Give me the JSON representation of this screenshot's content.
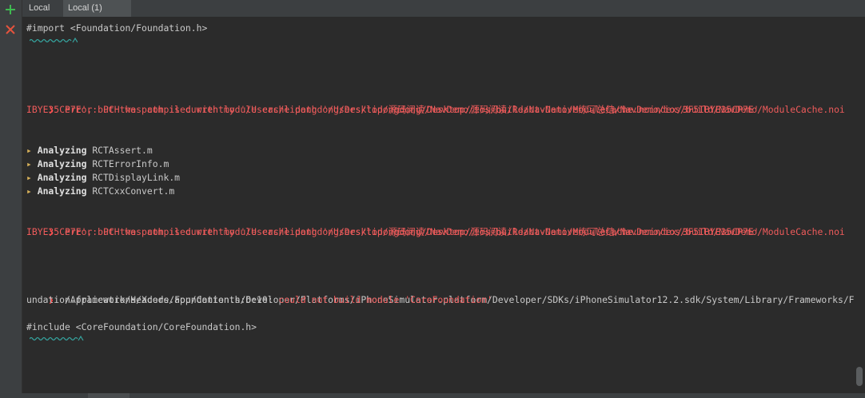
{
  "gutter": {
    "add_icon": "plus-icon",
    "close_icon": "close-icon",
    "add_color": "#3fb950",
    "close_color": "#e5533d"
  },
  "tabs": [
    {
      "label": "Local"
    },
    {
      "label": "Local (1)"
    }
  ],
  "console": {
    "import_line": "#import <Foundation/Foundation.h>",
    "error1_line1": "error: PCH was compiled with module cache path '/Users/lidongdong/Desktop/源码阅读/React-Native练习总结/NavDemo/ios/build/NavDemo/ModuleCache.noi",
    "error1_line2": "IBYE35CP7E', but the path is currently '/Users/lidongdong/Desktop/源码阅读/NavDemo/ios/build/NavDemo/ModuleCache.noindex/3F5IBYE35CP7E'",
    "analyzing_label": "Analyzing",
    "analyzing_files": [
      "RCTAssert.m",
      "RCTErrorInfo.m",
      "RCTDisplayLink.m",
      "RCTCxxConvert.m"
    ],
    "error2_line1": "error: PCH was compiled with module cache path '/Users/lidongdong/Desktop/源码阅读/React-Native练习总结/NavDemo/ios/build/NavDemo/ModuleCache.noi",
    "error2_line2": "IBYE35CP7E', but the path is currently '/Users/lidongdong/Desktop/源码阅读/NavDemo/ios/build/NavDemo/ModuleCache.noindex/3F5IBYE35CP7E'",
    "path_line1": "/Applications/Xcode.app/Contents/Developer/Platforms/iPhoneSimulator.platform/Developer/SDKs/iPhoneSimulator12.2.sdk/System/Library/Frameworks/Fo",
    "path_line2_prefix": "undation.framework/Headers/Foundation.h:6:10: ",
    "path_line2_error": "could not build module 'CoreFoundation'",
    "include_line": "#include <CoreFoundation/CoreFoundation.h>"
  }
}
